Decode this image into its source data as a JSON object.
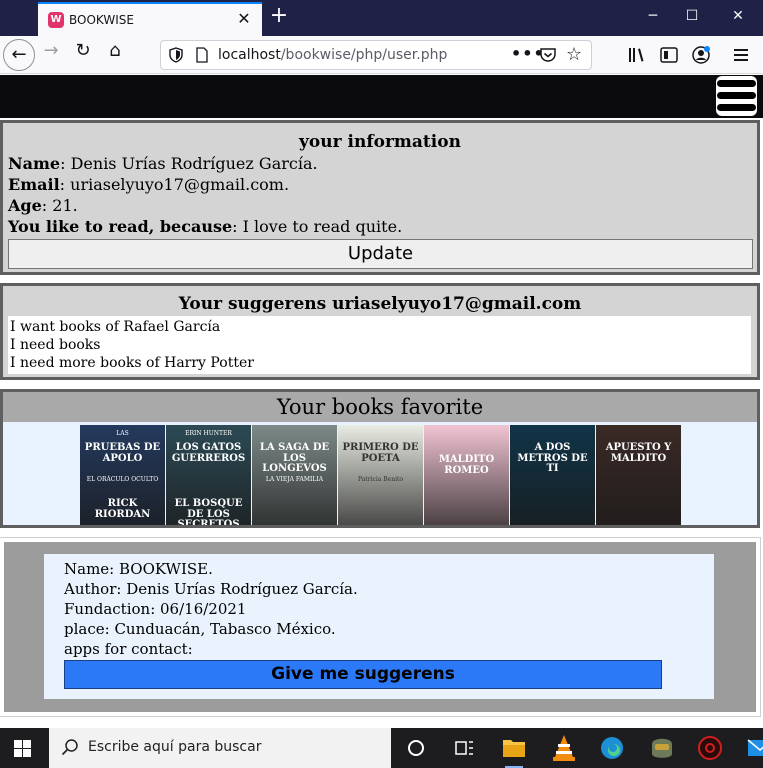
{
  "browser": {
    "tab_title": "BOOKWISE",
    "tab_favicon": "W",
    "new_tab_icon": "+",
    "url_host": "localhost",
    "url_path": "/bookwise/php/user.php",
    "url_more": "•••",
    "minimize_icon": "─",
    "maximize_icon": "☐",
    "close_icon": "✕"
  },
  "info": {
    "title": "your information",
    "name_label": "Name",
    "name_value": ": Denis Urías Rodríguez García.",
    "email_label": "Email",
    "email_value": ": uriaselyuyo17@gmail.com.",
    "age_label": "Age",
    "age_value": ": 21.",
    "reason_label": "You like to read, because",
    "reason_value": ": I love to read quite.",
    "update_label": "Update"
  },
  "suggestions": {
    "title": "Your suggerens uriaselyuyo17@gmail.com",
    "items": [
      "I want books of Rafael García",
      "I need books",
      "I need more books of Harry Potter"
    ]
  },
  "favorites": {
    "title": "Your books favorite",
    "books": [
      {
        "name": "book-cover-pruebas-de-apolo",
        "top": "LAS",
        "main": "PRUEBAS DE APOLO",
        "sub": "EL ORÁCULO OCULTO",
        "foot": "RICK RIORDAN",
        "color": "#243a5e"
      },
      {
        "name": "book-cover-gatos-guerreros",
        "top": "ERIN HUNTER",
        "main": "LOS GATOS GUERREROS",
        "sub": "",
        "foot": "EL BOSQUE DE LOS SECRETOS",
        "color": "#2c4a55"
      },
      {
        "name": "book-cover-saga-longevos",
        "top": "",
        "main": "LA SAGA DE LOS LONGEVOS",
        "sub": "LA VIEJA FAMILIA",
        "foot": "",
        "color": "#7d8a88"
      },
      {
        "name": "book-cover-primero-de-poeta",
        "top": "",
        "main": "PRIMERO DE POETA",
        "sub": "Patricia Benito",
        "foot": "",
        "color": "#e9ece3"
      },
      {
        "name": "book-cover-maldito-romeo",
        "top": "",
        "main": "MALDITO ROMEO",
        "sub": "",
        "foot": "",
        "color": "#f1c4d3"
      },
      {
        "name": "book-cover-a-dos-metros-de-ti",
        "top": "",
        "main": "A DOS METROS DE TI",
        "sub": "",
        "foot": "",
        "color": "#0f3447"
      },
      {
        "name": "book-cover-apuesto-y-maldito",
        "top": "",
        "main": "APUESTO Y MALDITO",
        "sub": "",
        "foot": "",
        "color": "#3a2a26"
      }
    ]
  },
  "about": {
    "name_line": "Name: BOOKWISE.",
    "author_line": "Author: Denis Urías Rodríguez García.",
    "foundation_line": "Fundaction: 06/16/2021",
    "place_line": "place: Cunduacán, Tabasco México.",
    "apps_line": "apps for contact:",
    "button_label": "Give me suggerens"
  },
  "taskbar": {
    "search_placeholder": "Escribe aquí para buscar"
  },
  "colors": {
    "header": "#0b0b0e",
    "panel_gray": "#d4d4d4",
    "favorites_bg": "#e9f3ff",
    "suggest_button": "#2c79f7"
  }
}
